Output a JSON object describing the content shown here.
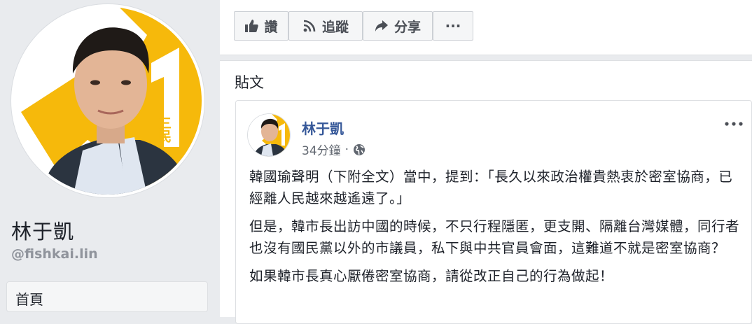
{
  "profile": {
    "name": "林于凱",
    "handle": "@fishkai.lin",
    "badge_number": "1",
    "badge_text": "三民"
  },
  "nav": {
    "home_label": "首頁"
  },
  "actions": {
    "like_label": "讚",
    "follow_label": "追蹤",
    "share_label": "分享",
    "more_label": "···"
  },
  "posts": {
    "heading": "貼文",
    "items": [
      {
        "author": "林于凱",
        "time": "34分鐘",
        "separator": "·",
        "privacy_icon": "globe-icon",
        "paragraphs": [
          "韓國瑜聲明（下附全文）當中，提到：「長久以來政治權貴熱衷於密室協商，已經離人民越來越遙遠了。」",
          "但是，韓市長出訪中國的時候，不只行程隱匿，更支開、隔離台灣媒體，同行者也沒有國民黨以外的市議員，私下與中共官員會面，這難道不就是密室協商？",
          "如果韓市長真心厭倦密室協商，請從改正自己的行為做起！"
        ]
      }
    ]
  },
  "colors": {
    "background": "#e9ebee",
    "link": "#365899",
    "badge_yellow": "#f6b90b",
    "muted": "#90949c"
  }
}
